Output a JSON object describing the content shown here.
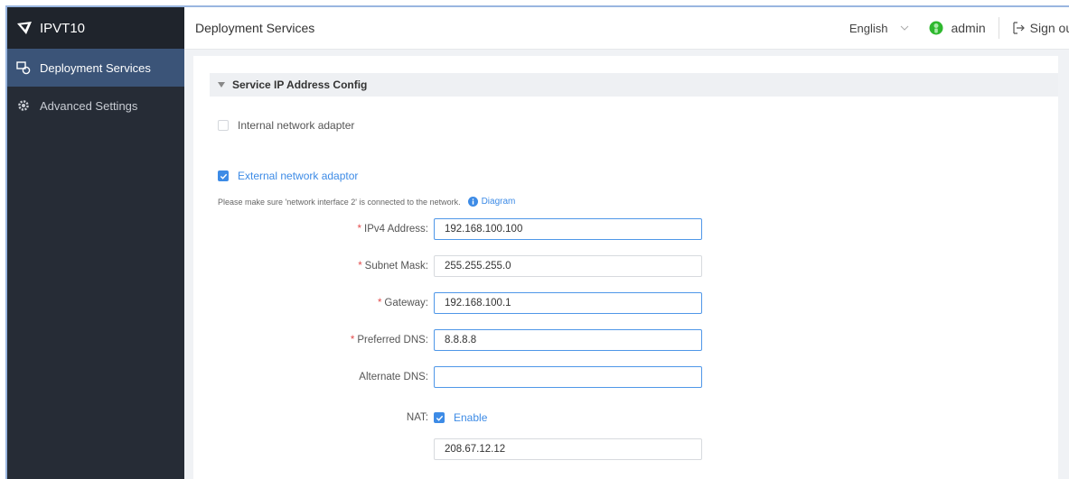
{
  "app": {
    "name": "IPVT10"
  },
  "sidebar": {
    "items": [
      {
        "label": "Deployment Services",
        "icon": "deployment-icon",
        "active": true
      },
      {
        "label": "Advanced Settings",
        "icon": "gear-icon",
        "active": false
      }
    ]
  },
  "header": {
    "title": "Deployment Services",
    "language": "English",
    "user": "admin",
    "signout": "Sign out"
  },
  "section": {
    "title": "Service IP Address Config"
  },
  "internal_adapter": {
    "label": "Internal network adapter",
    "checked": false
  },
  "external_adapter": {
    "label": "External network adaptor",
    "checked": true
  },
  "hint": {
    "text": "Please make sure 'network interface 2' is connected to the network.",
    "link": "Diagram"
  },
  "fields": {
    "ipv4": {
      "label": "IPv4 Address:",
      "value": "192.168.100.100",
      "required": true
    },
    "subnet": {
      "label": "Subnet Mask:",
      "value": "255.255.255.0",
      "required": true
    },
    "gateway": {
      "label": "Gateway:",
      "value": "192.168.100.1",
      "required": true
    },
    "preferred_dns": {
      "label": "Preferred DNS:",
      "value": "8.8.8.8",
      "required": true
    },
    "alternate_dns": {
      "label": "Alternate DNS:",
      "value": "",
      "required": false
    },
    "nat": {
      "label": "NAT:",
      "enable_label": "Enable",
      "checked": true,
      "value": "208.67.12.12"
    }
  },
  "colors": {
    "sidebar_bg": "#262c36",
    "sidebar_active": "#3b5478",
    "accent": "#3d8be6",
    "required": "#e34d4d",
    "user_status": "#2eb82e"
  }
}
